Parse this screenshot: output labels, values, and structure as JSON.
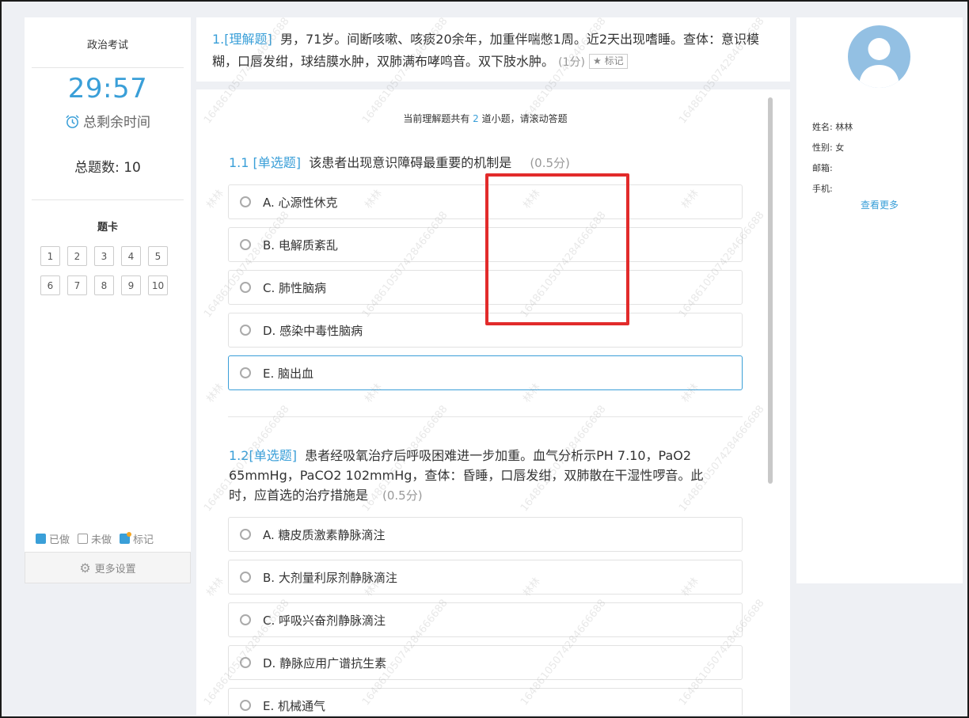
{
  "left": {
    "exam_title": "政治考试",
    "timer": "29:57",
    "remain_label": "总剩余时间",
    "total_label": "总题数: 10",
    "card_title": "题卡",
    "question_numbers": [
      "1",
      "2",
      "3",
      "4",
      "5",
      "6",
      "7",
      "8",
      "9",
      "10"
    ],
    "legend": {
      "done": "已做",
      "undone": "未做",
      "marked": "标记"
    },
    "more_settings": "更多设置"
  },
  "main_question": {
    "number": "1.",
    "type": "[理解题]",
    "text": "男，71岁。间断咳嗽、咳痰20余年，加重伴喘憋1周。近2天出现嗜睡。查体：意识模糊，口唇发绀，球结膜水肿，双肺满布哮鸣音。双下肢水肿。",
    "score": "(1分)",
    "mark_label": "标记"
  },
  "hint": {
    "prefix": "当前理解题共有",
    "count": "2",
    "suffix": "道小题，请滚动答题"
  },
  "subquestions": [
    {
      "number": "1.1",
      "type": "[单选题]",
      "text": "该患者出现意识障碍最重要的机制是",
      "score": "(0.5分)",
      "options": [
        "A. 心源性休克",
        "B. 电解质紊乱",
        "C. 肺性脑病",
        "D. 感染中毒性脑病",
        "E. 脑出血"
      ],
      "selected_index": 4
    },
    {
      "number": "1.2",
      "type": "[单选题]",
      "text_lines": [
        "患者经吸氧治疗后呼吸困难进一步加重。血气分析示PH 7.10，PaO2",
        "65mmHg，PaCO2 102mmHg，查体：昏睡，口唇发绀，双肺散在干湿性啰音。此",
        "时，应首选的治疗措施是"
      ],
      "score": "(0.5分)",
      "options": [
        "A. 糖皮质激素静脉滴注",
        "B. 大剂量利尿剂静脉滴注",
        "C. 呼吸兴奋剂静脉滴注",
        "D. 静脉应用广谱抗生素",
        "E. 机械通气"
      ]
    }
  ],
  "user": {
    "name_label": "姓名:",
    "name": "林林",
    "gender_label": "性别:",
    "gender": "女",
    "email_label": "邮箱:",
    "email": "",
    "phone_label": "手机:",
    "phone": "",
    "see_more": "查看更多"
  },
  "watermark": {
    "name": "林林",
    "phone": "16486105074284666688"
  },
  "colors": {
    "accent": "#3a9fd8",
    "annotation": "#e22b2b"
  }
}
